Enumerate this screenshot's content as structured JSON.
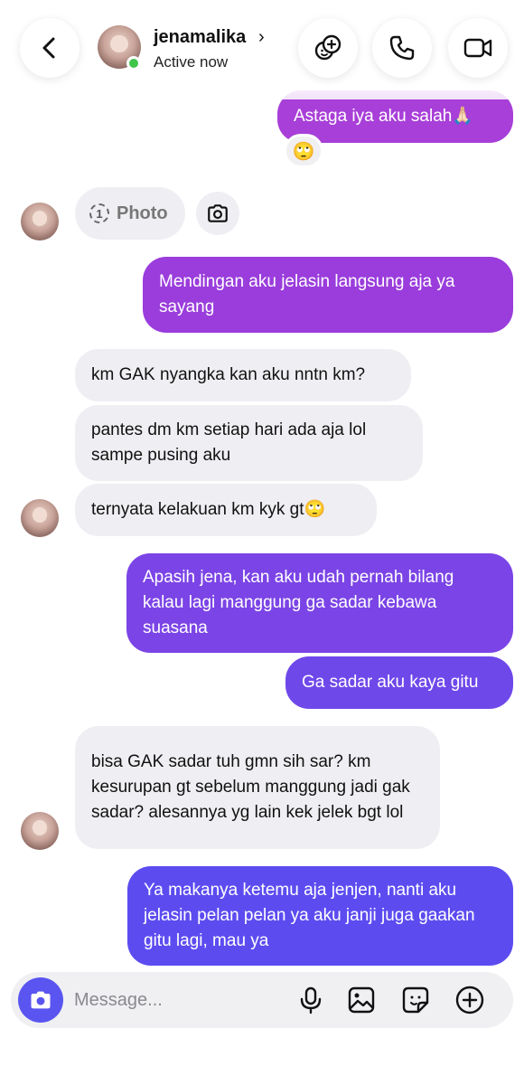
{
  "header": {
    "contact_name": "jenamalika",
    "chevron": "›",
    "status": "Active now",
    "icons": [
      "back-arrow-icon",
      "effects-icon",
      "phone-icon",
      "video-camera-icon"
    ]
  },
  "messages": [
    {
      "side": "out",
      "text": "Astaga iya aku salah🙏🏻",
      "reaction": "🙄"
    },
    {
      "side": "in",
      "type": "photo",
      "count": "1",
      "label": "Photo"
    },
    {
      "side": "out",
      "text": "Mendingan aku jelasin langsung aja ya sayang"
    },
    {
      "side": "in",
      "text": "km GAK nyangka kan aku nntn km?"
    },
    {
      "side": "in",
      "text": "pantes dm km setiap hari ada aja lol sampe pusing aku"
    },
    {
      "side": "in",
      "text": "ternyata kelakuan km kyk gt🙄"
    },
    {
      "side": "out",
      "text": "Apasih jena, kan aku udah pernah bilang kalau lagi manggung ga sadar kebawa suasana"
    },
    {
      "side": "out",
      "text": "Ga sadar aku kaya gitu"
    },
    {
      "side": "in",
      "text": "bisa GAK sadar tuh gmn sih sar? km kesurupan gt sebelum manggung jadi gak sadar? alesannya yg lain kek jelek bgt lol"
    },
    {
      "side": "out",
      "text": "Ya makanya ketemu aja jenjen, nanti aku jelasin pelan pelan ya aku janji juga gaakan gitu lagi, mau ya"
    }
  ],
  "composer": {
    "placeholder": "Message...",
    "value": "",
    "icons": [
      "camera-icon",
      "microphone-icon",
      "gallery-icon",
      "sticker-icon",
      "plus-icon"
    ]
  },
  "colors": {
    "bubble_out_top": "#a040d8",
    "bubble_out_bottom": "#5a4cf0",
    "bubble_in": "#efeff3",
    "camera_button": "#5a55f0",
    "online_dot": "#3ec54a"
  }
}
